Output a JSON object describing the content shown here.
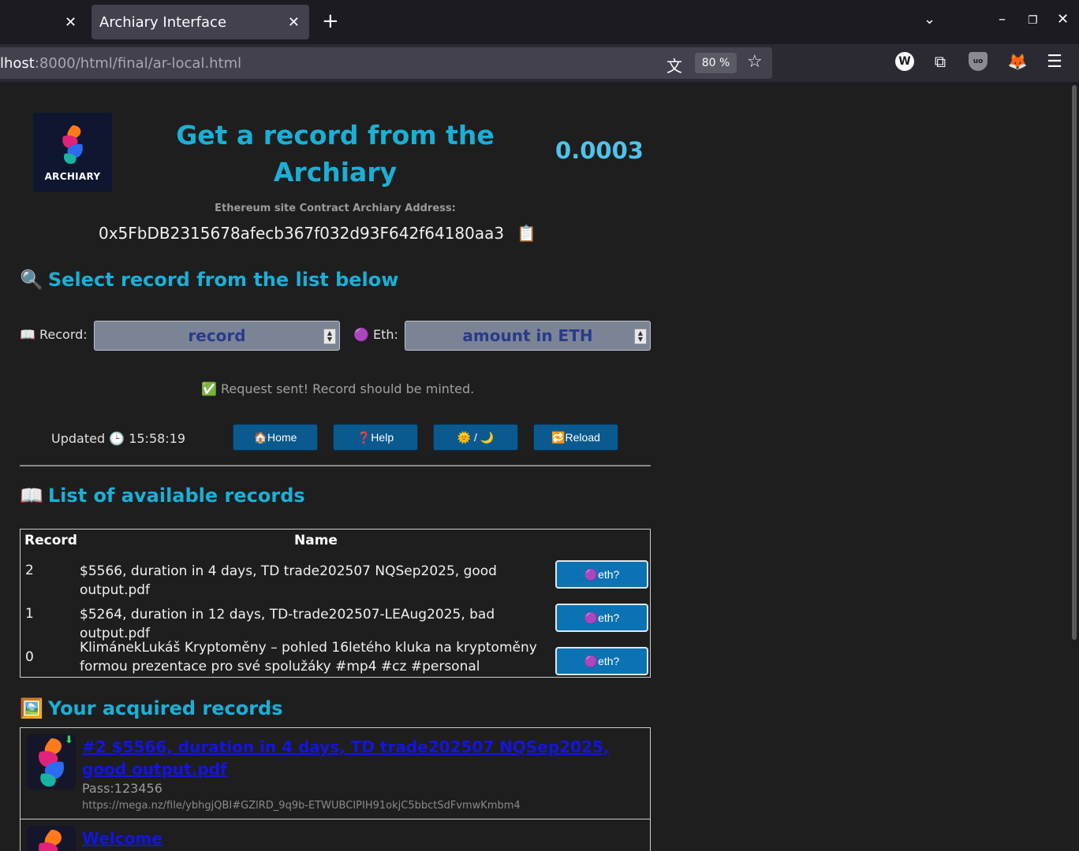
{
  "browser": {
    "prev_tab_close": "✕",
    "active_tab_title": "Archiary Interface",
    "active_tab_close": "✕",
    "new_tab": "+",
    "url_host": "lhost",
    "url_rest": ":8000/html/final/ar-local.html",
    "zoom": "80 %"
  },
  "header": {
    "logo_text": "ARCHIARY",
    "title": "Get a record from the Archiary",
    "balance": "0.0003",
    "address_label": "Ethereum site Contract Archiary Address:",
    "address": "0x5FbDB2315678afecb367f032d93F642f64180aa3",
    "copy_icon": "📋"
  },
  "select_section": {
    "heading_emoji": "🔍",
    "heading": "Select record from the list below",
    "record_label": "📖 Record:",
    "record_placeholder": "record",
    "eth_label": "🟣 Eth:",
    "eth_placeholder": "amount in ETH",
    "status": "✅ Request sent! Record should be minted."
  },
  "toolbar": {
    "updated_label": "Updated 🕒 15:58:19",
    "home": "🏠Home",
    "help": "❓Help",
    "theme": "🌞 / 🌙",
    "reload": "🔁Reload"
  },
  "records_section": {
    "heading_emoji": "📖",
    "heading": "List of available records",
    "col_record": "Record",
    "col_name": "Name",
    "rows": [
      {
        "id": "2",
        "name": "$5566, duration in 4 days, TD trade202507 NQSep2025, good output.pdf",
        "action": "🟣eth?"
      },
      {
        "id": "1",
        "name": "$5264, duration in 12 days, TD-trade202507-LEAug2025, bad output.pdf",
        "action": "🟣eth?"
      },
      {
        "id": "0",
        "name": "KlimánekLukáš Kryptoměny – pohled 16letého kluka na kryptoměny formou prezentace pro své spolužáky #mp4 #cz #personal",
        "action": "🟣eth?"
      }
    ]
  },
  "acquired_section": {
    "heading_emoji": "🖼️",
    "heading": "Your acquired records",
    "items": [
      {
        "title": "#2 $5566, duration in 4 days, TD trade202507 NQSep2025, good output.pdf",
        "pass": "Pass:123456",
        "link": "https://mega.nz/file/ybhgjQBI#GZlRD_9q9b-ETWUBCIPIH91okjC5bbctSdFvmwKmbm4"
      },
      {
        "title": "Welcome"
      }
    ]
  }
}
